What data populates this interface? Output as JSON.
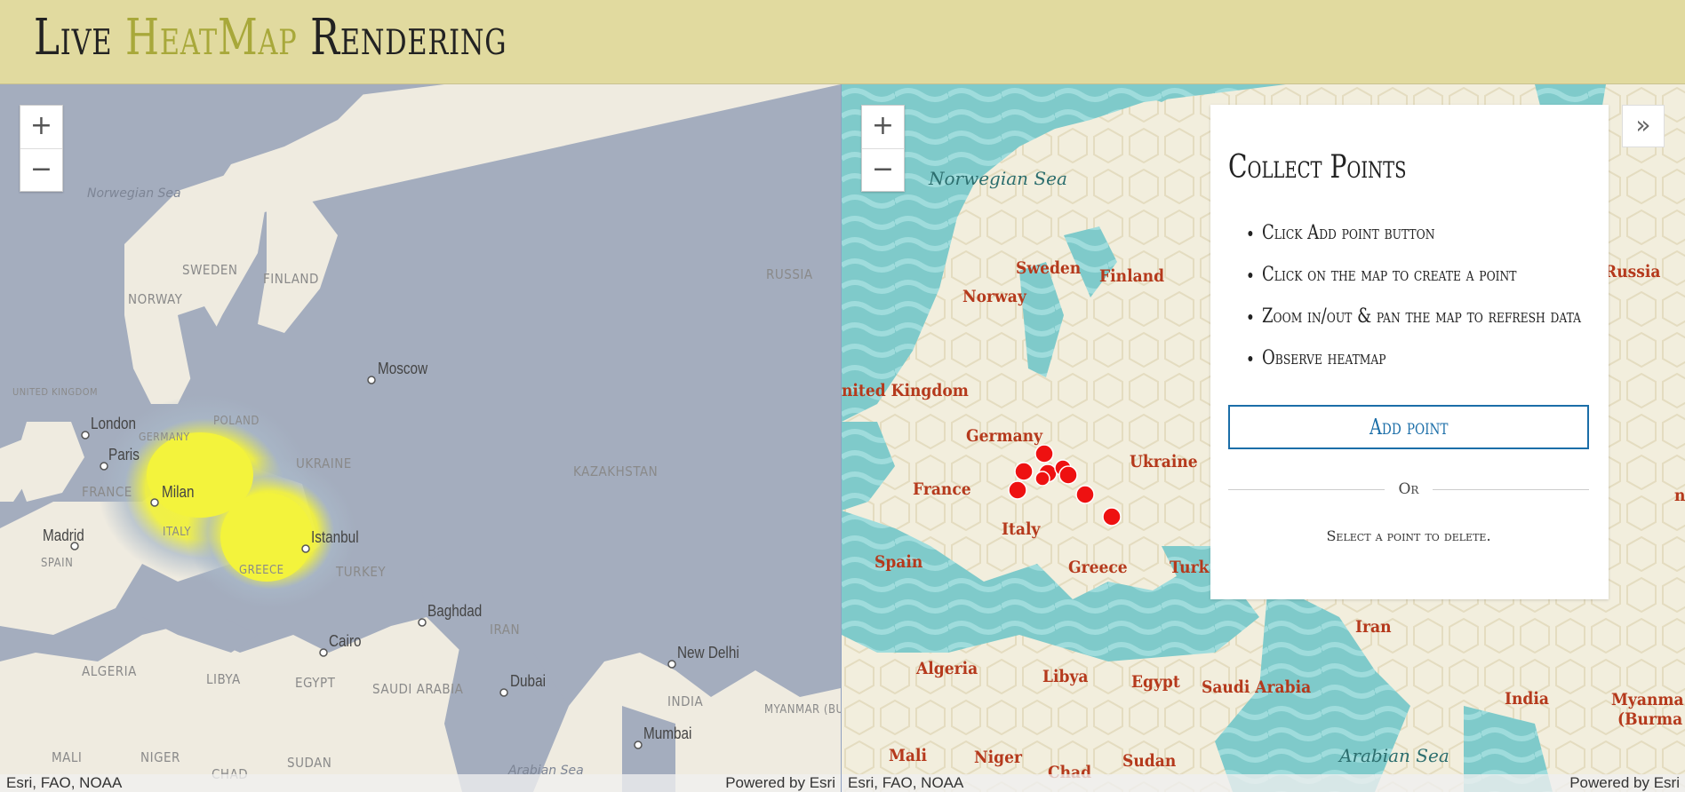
{
  "app": {
    "title_part1": "Live ",
    "title_highlight": "HeatMap",
    "title_part2": " Rendering"
  },
  "colors": {
    "header_bg": "#e1da9f",
    "land": "#efebe0",
    "water_left": "#a4adbe",
    "water_right": "#7fcaca",
    "heat_core": "#f3f33c",
    "point": "#ee1111",
    "button_accent": "#1b6ea8"
  },
  "left_map": {
    "zoom_in": "+",
    "zoom_out": "−",
    "attribution_left": "Esri, FAO, NOAA",
    "attribution_right": "Powered by Esri",
    "seas": [
      "Norwegian Sea",
      "Arabian Sea"
    ],
    "countries": [
      "SWEDEN",
      "FINLAND",
      "NORWAY",
      "RUSSIA",
      "UNITED KINGDOM",
      "GERMANY",
      "POLAND",
      "UKRAINE",
      "FRANCE",
      "KAZAKHSTAN",
      "SPAIN",
      "ITALY",
      "GREECE",
      "TURKEY",
      "IRAN",
      "ALGERIA",
      "LIBYA",
      "EGYPT",
      "SAUDI ARABIA",
      "INDIA",
      "MYANMAR (BUR",
      "MALI",
      "NIGER",
      "CHAD",
      "SUDAN"
    ],
    "cities": [
      "Moscow",
      "London",
      "Paris",
      "Milan",
      "Madrid",
      "Istanbul",
      "Baghdad",
      "Cairo",
      "Dubai",
      "New Delhi",
      "Mumbai"
    ]
  },
  "right_map": {
    "zoom_in": "+",
    "zoom_out": "−",
    "attribution_left": "Esri, FAO, NOAA",
    "attribution_right": "Powered by Esri",
    "seas": [
      "Norwegian Sea",
      "Arabian Sea"
    ],
    "countries": [
      "Sweden",
      "Finland",
      "Norway",
      "Russia",
      "nited Kingdom",
      "Germany",
      "Ukraine",
      "France",
      "Italy",
      "Spain",
      "Greece",
      "Turk",
      "Iran",
      "Algeria",
      "Libya",
      "Egypt",
      "Saudi Arabia",
      "India",
      "Myanma",
      "(Burma",
      "Mali",
      "Niger",
      "Chad",
      "Sudan",
      "n"
    ],
    "points_count": 9
  },
  "panel": {
    "title": "Collect Points",
    "steps": [
      "Click Add point button",
      "Click on the map to create a point",
      "Zoom in/out & pan the map to refresh data",
      "Observe heatmap"
    ],
    "add_button": "Add point",
    "or_text": "Or",
    "delete_hint": "Select a point to delete.",
    "collapse_icon": "»"
  }
}
